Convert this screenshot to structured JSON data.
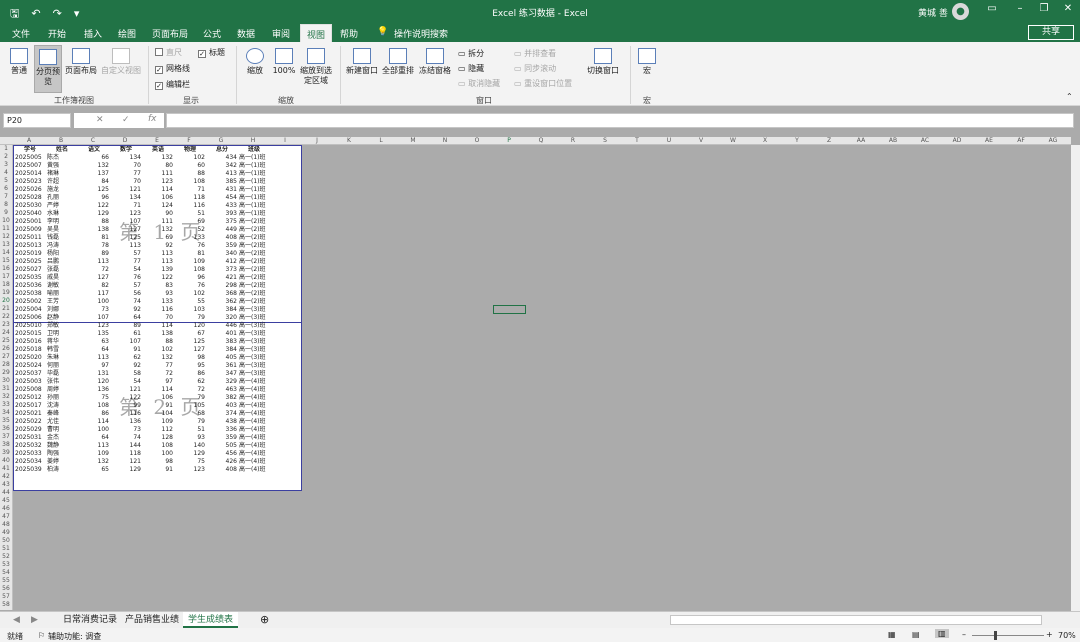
{
  "titlebar": {
    "title": "Excel 练习数据  -  Excel",
    "user": "黄城 善"
  },
  "menu_tabs": [
    "文件",
    "开始",
    "插入",
    "绘图",
    "页面布局",
    "公式",
    "数据",
    "审阅",
    "视图",
    "帮助"
  ],
  "search": "操作说明搜索",
  "share": "共享",
  "ribbon": {
    "groups": [
      "工作簿视图",
      "显示",
      "缩放",
      "窗口",
      "宏"
    ],
    "workbook_views": [
      "普通",
      "分页预览",
      "页面布局",
      "自定义视图"
    ],
    "show": {
      "ruler": "直尺",
      "gridlines": "网格线",
      "formula_bar": "编辑栏",
      "headings": "标题"
    },
    "zoom": {
      "zoom": "缩放",
      "hundred": "100%",
      "selection": "缩放到选定区域"
    },
    "window": {
      "new": "新建窗口",
      "arrange": "全部重排",
      "freeze": "冻结窗格",
      "split": "拆分",
      "hide": "隐藏",
      "unhide": "取消隐藏",
      "side": "并排查看",
      "sync": "同步滚动",
      "reset": "重设窗口位置",
      "switch": "切换窗口"
    },
    "macro": "宏"
  },
  "namebox": "P20",
  "fx": "fx",
  "columns": [
    "A",
    "B",
    "C",
    "D",
    "E",
    "F",
    "G",
    "H",
    "I",
    "J",
    "K",
    "L",
    "M",
    "N",
    "O",
    "P",
    "Q",
    "R",
    "S",
    "T",
    "U",
    "V",
    "W",
    "X",
    "Y",
    "Z",
    "AA",
    "AB",
    "AC",
    "AD",
    "AE",
    "AF",
    "AG"
  ],
  "headers": [
    "学号",
    "姓名",
    "语文",
    "数学",
    "英语",
    "物理",
    "总分",
    "班级"
  ],
  "rows": [
    [
      "2025005",
      "陈杰",
      "66",
      "134",
      "132",
      "102",
      "434",
      "高一(1)班"
    ],
    [
      "2025007",
      "黄强",
      "132",
      "70",
      "80",
      "60",
      "342",
      "高一(1)班"
    ],
    [
      "2025014",
      "褚琳",
      "137",
      "77",
      "111",
      "88",
      "413",
      "高一(1)班"
    ],
    [
      "2025023",
      "许超",
      "84",
      "70",
      "123",
      "108",
      "385",
      "高一(1)班"
    ],
    [
      "2025026",
      "施龙",
      "125",
      "121",
      "114",
      "71",
      "431",
      "高一(1)班"
    ],
    [
      "2025028",
      "孔丽",
      "96",
      "134",
      "106",
      "118",
      "454",
      "高一(1)班"
    ],
    [
      "2025030",
      "严婷",
      "122",
      "71",
      "124",
      "116",
      "433",
      "高一(1)班"
    ],
    [
      "2025040",
      "水琳",
      "129",
      "123",
      "90",
      "51",
      "393",
      "高一(1)班"
    ],
    [
      "2025001",
      "李明",
      "88",
      "107",
      "111",
      "69",
      "375",
      "高一(2)班"
    ],
    [
      "2025009",
      "吴昊",
      "138",
      "127",
      "132",
      "52",
      "449",
      "高一(2)班"
    ],
    [
      "2025011",
      "钱磊",
      "81",
      "125",
      "69",
      "133",
      "408",
      "高一(2)班"
    ],
    [
      "2025013",
      "冯涛",
      "78",
      "113",
      "92",
      "76",
      "359",
      "高一(2)班"
    ],
    [
      "2025019",
      "杨阳",
      "89",
      "57",
      "113",
      "81",
      "340",
      "高一(2)班"
    ],
    [
      "2025025",
      "吕鹏",
      "113",
      "77",
      "113",
      "109",
      "412",
      "高一(2)班"
    ],
    [
      "2025027",
      "张磊",
      "72",
      "54",
      "139",
      "108",
      "373",
      "高一(2)班"
    ],
    [
      "2025035",
      "戚昊",
      "127",
      "76",
      "122",
      "96",
      "421",
      "高一(2)班"
    ],
    [
      "2025036",
      "谢敏",
      "82",
      "57",
      "83",
      "76",
      "298",
      "高一(2)班"
    ],
    [
      "2025038",
      "喻丽",
      "117",
      "56",
      "93",
      "102",
      "368",
      "高一(2)班"
    ],
    [
      "2025002",
      "王芳",
      "100",
      "74",
      "133",
      "55",
      "362",
      "高一(2)班"
    ],
    [
      "2025004",
      "刘娜",
      "73",
      "92",
      "116",
      "103",
      "384",
      "高一(3)班"
    ],
    [
      "2025006",
      "赵静",
      "107",
      "64",
      "70",
      "79",
      "320",
      "高一(3)班"
    ],
    [
      "2025010",
      "郑敏",
      "123",
      "89",
      "114",
      "120",
      "446",
      "高一(3)班"
    ],
    [
      "2025015",
      "卫明",
      "135",
      "61",
      "138",
      "67",
      "401",
      "高一(3)班"
    ],
    [
      "2025016",
      "蒋华",
      "63",
      "107",
      "88",
      "125",
      "383",
      "高一(3)班"
    ],
    [
      "2025018",
      "韩雪",
      "64",
      "91",
      "102",
      "127",
      "384",
      "高一(3)班"
    ],
    [
      "2025020",
      "朱琳",
      "113",
      "62",
      "132",
      "98",
      "405",
      "高一(3)班"
    ],
    [
      "2025024",
      "何丽",
      "97",
      "92",
      "77",
      "95",
      "361",
      "高一(3)班"
    ],
    [
      "2025037",
      "毕磊",
      "131",
      "58",
      "72",
      "86",
      "347",
      "高一(3)班"
    ],
    [
      "2025003",
      "张伟",
      "120",
      "54",
      "97",
      "62",
      "329",
      "高一(4)班"
    ],
    [
      "2025008",
      "周婷",
      "136",
      "121",
      "114",
      "72",
      "463",
      "高一(4)班"
    ],
    [
      "2025012",
      "孙丽",
      "75",
      "122",
      "106",
      "79",
      "382",
      "高一(4)班"
    ],
    [
      "2025017",
      "沈涛",
      "108",
      "99",
      "91",
      "105",
      "403",
      "高一(4)班"
    ],
    [
      "2025021",
      "秦峰",
      "86",
      "116",
      "104",
      "68",
      "374",
      "高一(4)班"
    ],
    [
      "2025022",
      "尤佳",
      "114",
      "136",
      "109",
      "79",
      "438",
      "高一(4)班"
    ],
    [
      "2025029",
      "曹明",
      "100",
      "73",
      "112",
      "51",
      "336",
      "高一(4)班"
    ],
    [
      "2025031",
      "金杰",
      "64",
      "74",
      "128",
      "93",
      "359",
      "高一(4)班"
    ],
    [
      "2025032",
      "魏静",
      "113",
      "144",
      "108",
      "140",
      "505",
      "高一(4)班"
    ],
    [
      "2025033",
      "陶强",
      "109",
      "118",
      "100",
      "129",
      "456",
      "高一(4)班"
    ],
    [
      "2025034",
      "姜婷",
      "132",
      "121",
      "98",
      "75",
      "426",
      "高一(4)班"
    ],
    [
      "2025039",
      "柏涛",
      "65",
      "129",
      "91",
      "123",
      "408",
      "高一(4)班"
    ]
  ],
  "watermarks": [
    "第 1 页",
    "第 2 页"
  ],
  "sheet_tabs": [
    "日常消费记录",
    "产品销售业绩",
    "学生成绩表"
  ],
  "status": {
    "ready": "就绪",
    "accessibility": "辅助功能: 调查",
    "zoom": "70%"
  }
}
